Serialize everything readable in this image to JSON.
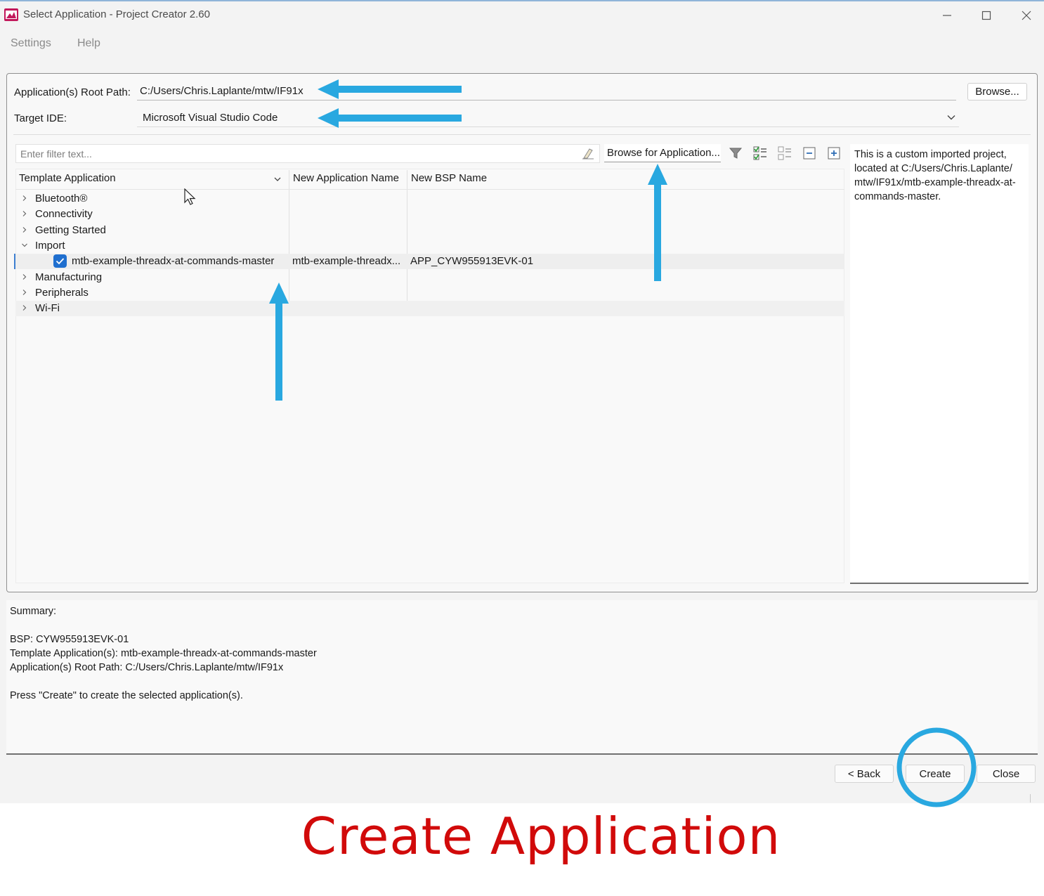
{
  "window": {
    "title": "Select Application - Project Creator 2.60"
  },
  "menu": {
    "items": [
      "Settings",
      "Help"
    ]
  },
  "root_path": {
    "label": "Application(s) Root Path:",
    "value": "C:/Users/Chris.Laplante/mtw/IF91x",
    "browse_label": "Browse..."
  },
  "target_ide": {
    "label": "Target IDE:",
    "selected": "Microsoft Visual Studio Code"
  },
  "filter": {
    "placeholder": "Enter filter text...",
    "browse_app_label": "Browse for Application..."
  },
  "tree": {
    "columns": [
      "Template Application",
      "New Application Name",
      "New BSP Name"
    ],
    "categories": [
      {
        "label": "Bluetooth®",
        "expanded": false
      },
      {
        "label": "Connectivity",
        "expanded": false
      },
      {
        "label": "Getting Started",
        "expanded": false
      },
      {
        "label": "Import",
        "expanded": true
      },
      {
        "label": "Manufacturing",
        "expanded": false
      },
      {
        "label": "Peripherals",
        "expanded": false
      },
      {
        "label": "Wi-Fi",
        "expanded": false
      }
    ],
    "selected_item": {
      "template": "mtb-example-threadx-at-commands-master",
      "app_name": "mtb-example-threadx...",
      "bsp_name": "APP_CYW955913EVK-01",
      "checked": true
    }
  },
  "description": "This is a custom imported project, located at C:/Users/Chris.Laplante/ mtw/IF91x/mtb-example-threadx-at- commands-master.",
  "summary": {
    "title": "Summary:",
    "bsp": "BSP: CYW955913EVK-01",
    "template": "Template Application(s): mtb-example-threadx-at-commands-master",
    "root_path": "Application(s) Root Path: C:/Users/Chris.Laplante/mtw/IF91x",
    "instruction": "Press \"Create\" to create the selected application(s)."
  },
  "buttons": {
    "back": "< Back",
    "create": "Create",
    "close": "Close"
  },
  "caption": "Create Application",
  "colors": {
    "annotation_arrow": "#29a8e0",
    "caption": "#d10a0a",
    "checkbox": "#1f6fcf"
  }
}
